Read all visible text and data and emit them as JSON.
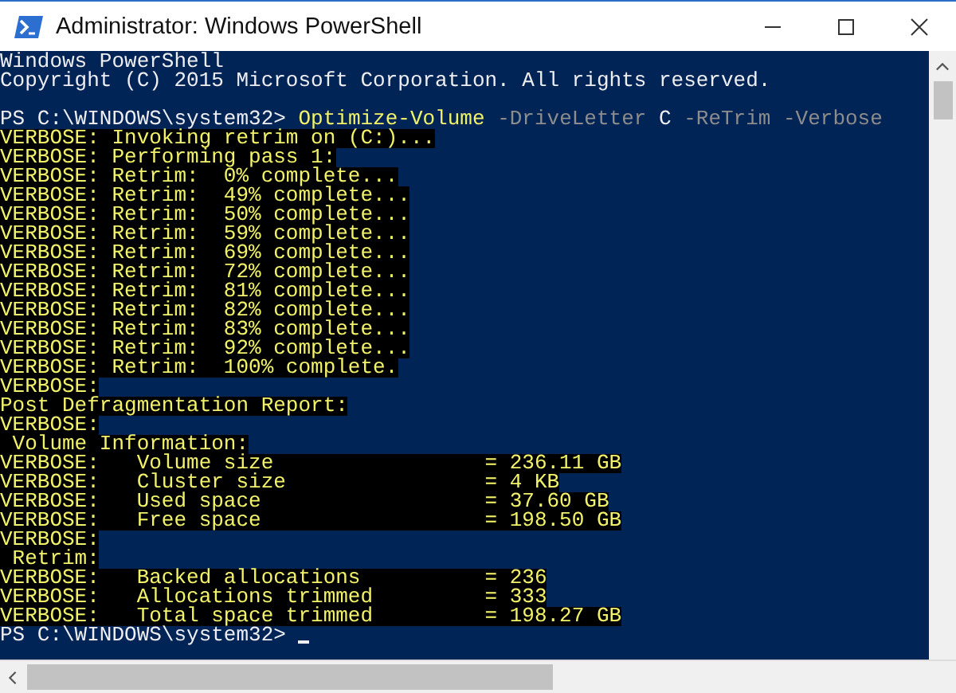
{
  "window": {
    "title": "Administrator: Windows PowerShell"
  },
  "console": {
    "lines": [
      {
        "kind": "plain",
        "text": "Windows PowerShell"
      },
      {
        "kind": "plain",
        "text": "Copyright (C) 2015 Microsoft Corporation. All rights reserved."
      },
      {
        "kind": "blank"
      },
      {
        "kind": "prompt",
        "cursor": false,
        "segments": [
          {
            "kind": "prompt",
            "text": "PS C:\\WINDOWS\\system32>"
          },
          {
            "kind": "command",
            "text": "Optimize-Volume"
          },
          {
            "kind": "parameter",
            "text": "-DriveLetter"
          },
          {
            "kind": "argument",
            "text": "C"
          },
          {
            "kind": "parameter",
            "text": "-ReTrim"
          },
          {
            "kind": "parameter",
            "text": "-Verbose"
          }
        ]
      },
      {
        "kind": "verbose",
        "text": "VERBOSE: Invoking retrim on (C:)..."
      },
      {
        "kind": "verbose",
        "text": "VERBOSE: Performing pass 1:"
      },
      {
        "kind": "verbose",
        "text": "VERBOSE: Retrim:  0% complete..."
      },
      {
        "kind": "verbose",
        "text": "VERBOSE: Retrim:  49% complete..."
      },
      {
        "kind": "verbose",
        "text": "VERBOSE: Retrim:  50% complete..."
      },
      {
        "kind": "verbose",
        "text": "VERBOSE: Retrim:  59% complete..."
      },
      {
        "kind": "verbose",
        "text": "VERBOSE: Retrim:  69% complete..."
      },
      {
        "kind": "verbose",
        "text": "VERBOSE: Retrim:  72% complete..."
      },
      {
        "kind": "verbose",
        "text": "VERBOSE: Retrim:  81% complete..."
      },
      {
        "kind": "verbose",
        "text": "VERBOSE: Retrim:  82% complete..."
      },
      {
        "kind": "verbose",
        "text": "VERBOSE: Retrim:  83% complete..."
      },
      {
        "kind": "verbose",
        "text": "VERBOSE: Retrim:  92% complete..."
      },
      {
        "kind": "verbose",
        "text": "VERBOSE: Retrim:  100% complete."
      },
      {
        "kind": "verbose",
        "text": "VERBOSE:"
      },
      {
        "kind": "verbose",
        "text": "Post Defragmentation Report:"
      },
      {
        "kind": "verbose",
        "text": "VERBOSE:"
      },
      {
        "kind": "verbose",
        "text": " Volume Information:"
      },
      {
        "kind": "verbose",
        "text": "VERBOSE:   Volume size                 = 236.11 GB"
      },
      {
        "kind": "verbose",
        "text": "VERBOSE:   Cluster size                = 4 KB"
      },
      {
        "kind": "verbose",
        "text": "VERBOSE:   Used space                  = 37.60 GB"
      },
      {
        "kind": "verbose",
        "text": "VERBOSE:   Free space                  = 198.50 GB"
      },
      {
        "kind": "verbose",
        "text": "VERBOSE:"
      },
      {
        "kind": "verbose",
        "text": " Retrim:"
      },
      {
        "kind": "verbose",
        "text": "VERBOSE:   Backed allocations          = 236"
      },
      {
        "kind": "verbose",
        "text": "VERBOSE:   Allocations trimmed         = 333"
      },
      {
        "kind": "verbose",
        "text": "VERBOSE:   Total space trimmed         = 198.27 GB"
      },
      {
        "kind": "prompt",
        "cursor": true,
        "segments": [
          {
            "kind": "prompt",
            "text": "PS C:\\WINDOWS\\system32>"
          }
        ]
      }
    ]
  }
}
